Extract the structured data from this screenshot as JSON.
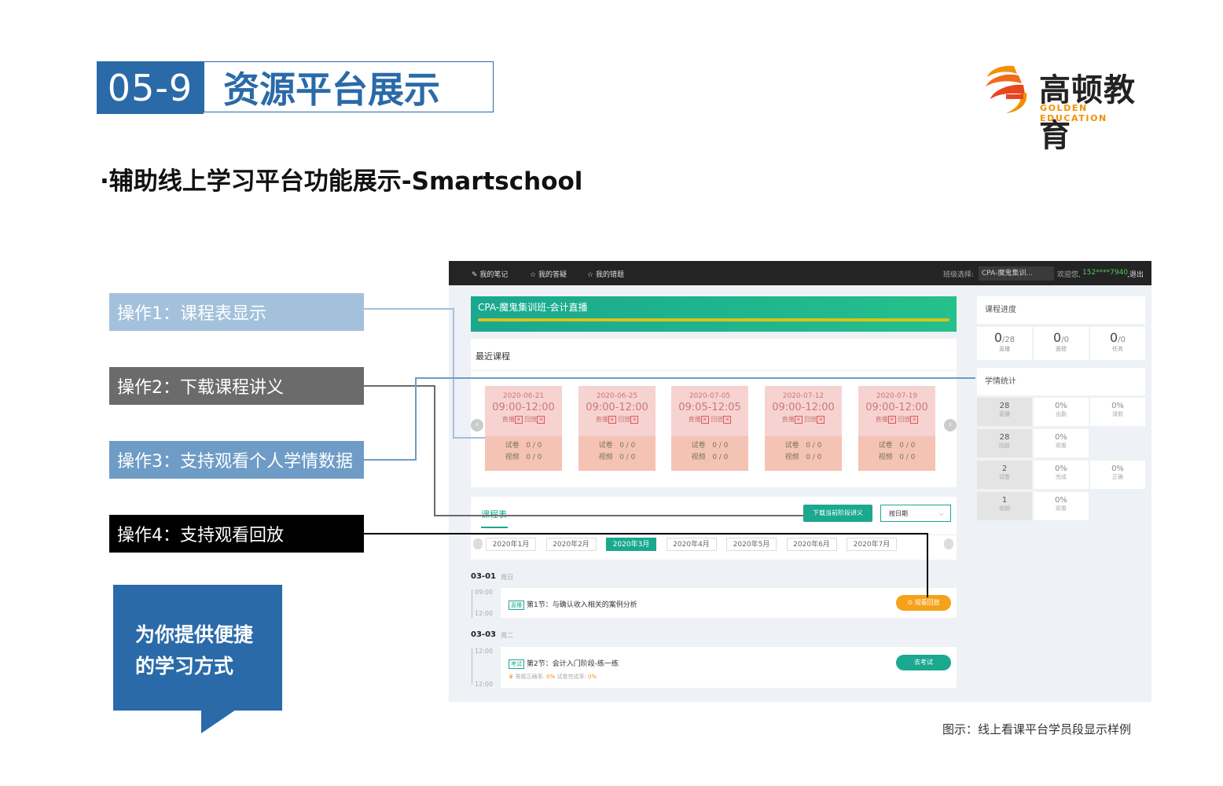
{
  "header": {
    "number": "05-9",
    "title": "资源平台展示"
  },
  "logo": {
    "cn": "高顿教育",
    "en": "GOLDEN EDUCATION"
  },
  "subtitle": "·辅助线上学习平台功能展示-Smartschool",
  "operations": [
    {
      "label": "操作1：课程表显示"
    },
    {
      "label": "操作2：下载课程讲义"
    },
    {
      "label": "操作3：支持观看个人学情数据"
    },
    {
      "label": "操作4：支持观看回放"
    }
  ],
  "bubble": {
    "line1": "为你提供便捷",
    "line2": "的学习方式"
  },
  "caption": "图示：线上看课平台学员段显示样例",
  "app": {
    "topbar": {
      "notes": "我的笔记",
      "answers": "我的答疑",
      "errors": "我的错题",
      "class_label": "班级选择:",
      "class_value": "CPA-魔鬼集训...",
      "welcome": "欢迎您,",
      "phone": "152****7940",
      "logout": ",退出"
    },
    "banner_title": "CPA-魔鬼集训班-会计直播",
    "recent_title": "最近课程",
    "lessons": [
      {
        "date": "2020-06-21",
        "time": "09:00-12:00",
        "live": "直播",
        "replay": "回放",
        "exam": "试卷",
        "exam_v": "0 / 0",
        "video": "视频",
        "video_v": "0 / 0"
      },
      {
        "date": "2020-06-25",
        "time": "09:00-12:00",
        "live": "直播",
        "replay": "回放",
        "exam": "试卷",
        "exam_v": "0 / 0",
        "video": "视频",
        "video_v": "0 / 0"
      },
      {
        "date": "2020-07-05",
        "time": "09:05-12:05",
        "live": "直播",
        "replay": "回放",
        "exam": "试卷",
        "exam_v": "0 / 0",
        "video": "视频",
        "video_v": "0 / 0"
      },
      {
        "date": "2020-07-12",
        "time": "09:00-12:00",
        "live": "直播",
        "replay": "回放",
        "exam": "试卷",
        "exam_v": "0 / 0",
        "video": "视频",
        "video_v": "0 / 0"
      },
      {
        "date": "2020-07-19",
        "time": "09:00-12:00",
        "live": "直播",
        "replay": "回放",
        "exam": "试卷",
        "exam_v": "0 / 0",
        "video": "视频",
        "video_v": "0 / 0"
      }
    ],
    "schedule_tab": "课程表",
    "download_btn": "下载当前阶段讲义",
    "sort_select": "按日期",
    "months": [
      "2020年1月",
      "2020年2月",
      "2020年3月",
      "2020年4月",
      "2020年5月",
      "2020年6月",
      "2020年7月"
    ],
    "active_month": "2020年3月",
    "days": [
      {
        "date": "03-01",
        "weekday": "周日",
        "start": "09:00",
        "end": "12:00",
        "tag": "直播",
        "title": "第1节：与确认收入相关的案例分析",
        "button": "观看回放"
      },
      {
        "date": "03-03",
        "weekday": "周二",
        "start": "12:00",
        "end": "12:00",
        "tag": "考试",
        "title": "第2节：会计入门阶段-练一练",
        "button": "去考试",
        "stat1_label": "答题正确率:",
        "stat1": "0%",
        "stat2_label": "试卷完成率:",
        "stat2": "0%"
      }
    ],
    "progress": {
      "title": "课程进度",
      "cells": [
        {
          "value": "0",
          "total": "/28",
          "label": "直播"
        },
        {
          "value": "0",
          "total": "/0",
          "label": "面授"
        },
        {
          "value": "0",
          "total": "/0",
          "label": "任务"
        }
      ]
    },
    "stats": {
      "title": "学情统计",
      "rows": [
        [
          {
            "v": "28",
            "l": "直播"
          },
          {
            "v": "0%",
            "l": "出勤"
          },
          {
            "v": "0%",
            "l": "请假"
          }
        ],
        [
          {
            "v": "28",
            "l": "回放"
          },
          {
            "v": "0%",
            "l": "观看"
          }
        ],
        [
          {
            "v": "2",
            "l": "试卷"
          },
          {
            "v": "0%",
            "l": "完成"
          },
          {
            "v": "0%",
            "l": "正确"
          }
        ],
        [
          {
            "v": "1",
            "l": "视频"
          },
          {
            "v": "0%",
            "l": "观看"
          }
        ]
      ]
    }
  },
  "colors": {
    "brand_blue": "#2a6aa8",
    "teal": "#1aa88f",
    "orange": "#f5a21a"
  }
}
